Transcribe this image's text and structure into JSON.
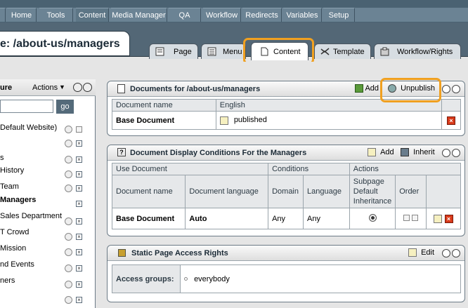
{
  "nav": {
    "items": [
      "Home",
      "Tools",
      "Content",
      "Media Manager",
      "QA",
      "Workflow",
      "Redirects",
      "Variables",
      "Setup"
    ],
    "active": "Content"
  },
  "page": {
    "title": "e: /about-us/managers"
  },
  "tabs": [
    {
      "label": "Page",
      "icon": "page-icon"
    },
    {
      "label": "Menu",
      "icon": "menu-icon"
    },
    {
      "label": "Content",
      "icon": "document-icon"
    },
    {
      "label": "Template",
      "icon": "template-icon"
    },
    {
      "label": "Workflow/Rights",
      "icon": "workflow-icon"
    }
  ],
  "sidebar": {
    "title": "ure",
    "actions_label": "Actions",
    "search_button": "go",
    "tree": [
      "Default Website)",
      "",
      "s",
      "History",
      "Team",
      "Managers",
      "Sales Department",
      "T Crowd",
      "Mission",
      "nd Events",
      "ners",
      ""
    ]
  },
  "documents_panel": {
    "title": "Documents for /about-us/managers",
    "add_label": "Add",
    "unpublish_label": "Unpublish",
    "col_name": "Document name",
    "col_lang": "English",
    "row_name": "Base Document",
    "row_status": "published"
  },
  "conditions_panel": {
    "title": "Document Display Conditions For the Managers",
    "add_label": "Add",
    "inherit_label": "Inherit",
    "group_use": "Use Document",
    "group_conditions": "Conditions",
    "group_actions": "Actions",
    "col_doc_name": "Document name",
    "col_doc_lang": "Document language",
    "col_domain": "Domain",
    "col_language": "Language",
    "col_subpage": "Subpage Default Inheritance",
    "col_order": "Order",
    "row_name": "Base Document",
    "row_lang": "Auto",
    "row_domain": "Any",
    "row_language": "Any"
  },
  "access_panel": {
    "title": "Static Page Access Rights",
    "edit_label": "Edit",
    "label": "Access groups:",
    "value": "everybody"
  },
  "colors": {
    "highlight": "#f0a020",
    "nav_bg": "#6b8394",
    "delete_red": "#d83a1a"
  }
}
